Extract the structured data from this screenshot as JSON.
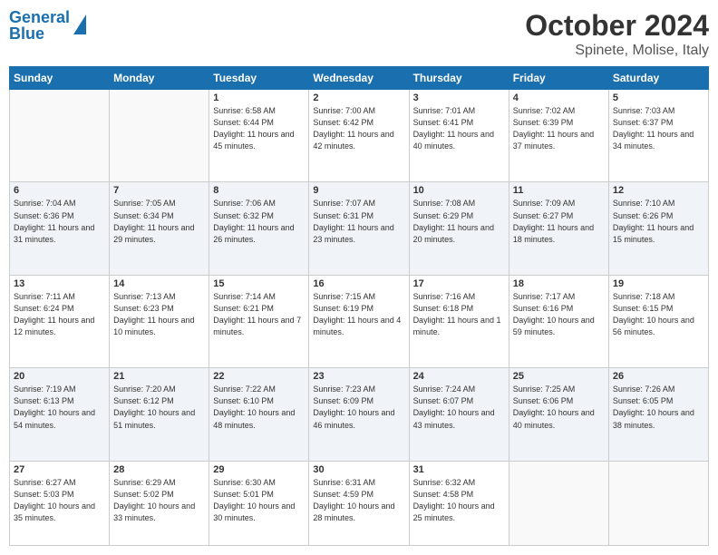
{
  "logo": {
    "line1": "General",
    "line2": "Blue"
  },
  "title": "October 2024",
  "subtitle": "Spinete, Molise, Italy",
  "weekdays": [
    "Sunday",
    "Monday",
    "Tuesday",
    "Wednesday",
    "Thursday",
    "Friday",
    "Saturday"
  ],
  "rows": [
    [
      {
        "day": "",
        "sunrise": "",
        "sunset": "",
        "daylight": ""
      },
      {
        "day": "",
        "sunrise": "",
        "sunset": "",
        "daylight": ""
      },
      {
        "day": "1",
        "sunrise": "Sunrise: 6:58 AM",
        "sunset": "Sunset: 6:44 PM",
        "daylight": "Daylight: 11 hours and 45 minutes."
      },
      {
        "day": "2",
        "sunrise": "Sunrise: 7:00 AM",
        "sunset": "Sunset: 6:42 PM",
        "daylight": "Daylight: 11 hours and 42 minutes."
      },
      {
        "day": "3",
        "sunrise": "Sunrise: 7:01 AM",
        "sunset": "Sunset: 6:41 PM",
        "daylight": "Daylight: 11 hours and 40 minutes."
      },
      {
        "day": "4",
        "sunrise": "Sunrise: 7:02 AM",
        "sunset": "Sunset: 6:39 PM",
        "daylight": "Daylight: 11 hours and 37 minutes."
      },
      {
        "day": "5",
        "sunrise": "Sunrise: 7:03 AM",
        "sunset": "Sunset: 6:37 PM",
        "daylight": "Daylight: 11 hours and 34 minutes."
      }
    ],
    [
      {
        "day": "6",
        "sunrise": "Sunrise: 7:04 AM",
        "sunset": "Sunset: 6:36 PM",
        "daylight": "Daylight: 11 hours and 31 minutes."
      },
      {
        "day": "7",
        "sunrise": "Sunrise: 7:05 AM",
        "sunset": "Sunset: 6:34 PM",
        "daylight": "Daylight: 11 hours and 29 minutes."
      },
      {
        "day": "8",
        "sunrise": "Sunrise: 7:06 AM",
        "sunset": "Sunset: 6:32 PM",
        "daylight": "Daylight: 11 hours and 26 minutes."
      },
      {
        "day": "9",
        "sunrise": "Sunrise: 7:07 AM",
        "sunset": "Sunset: 6:31 PM",
        "daylight": "Daylight: 11 hours and 23 minutes."
      },
      {
        "day": "10",
        "sunrise": "Sunrise: 7:08 AM",
        "sunset": "Sunset: 6:29 PM",
        "daylight": "Daylight: 11 hours and 20 minutes."
      },
      {
        "day": "11",
        "sunrise": "Sunrise: 7:09 AM",
        "sunset": "Sunset: 6:27 PM",
        "daylight": "Daylight: 11 hours and 18 minutes."
      },
      {
        "day": "12",
        "sunrise": "Sunrise: 7:10 AM",
        "sunset": "Sunset: 6:26 PM",
        "daylight": "Daylight: 11 hours and 15 minutes."
      }
    ],
    [
      {
        "day": "13",
        "sunrise": "Sunrise: 7:11 AM",
        "sunset": "Sunset: 6:24 PM",
        "daylight": "Daylight: 11 hours and 12 minutes."
      },
      {
        "day": "14",
        "sunrise": "Sunrise: 7:13 AM",
        "sunset": "Sunset: 6:23 PM",
        "daylight": "Daylight: 11 hours and 10 minutes."
      },
      {
        "day": "15",
        "sunrise": "Sunrise: 7:14 AM",
        "sunset": "Sunset: 6:21 PM",
        "daylight": "Daylight: 11 hours and 7 minutes."
      },
      {
        "day": "16",
        "sunrise": "Sunrise: 7:15 AM",
        "sunset": "Sunset: 6:19 PM",
        "daylight": "Daylight: 11 hours and 4 minutes."
      },
      {
        "day": "17",
        "sunrise": "Sunrise: 7:16 AM",
        "sunset": "Sunset: 6:18 PM",
        "daylight": "Daylight: 11 hours and 1 minute."
      },
      {
        "day": "18",
        "sunrise": "Sunrise: 7:17 AM",
        "sunset": "Sunset: 6:16 PM",
        "daylight": "Daylight: 10 hours and 59 minutes."
      },
      {
        "day": "19",
        "sunrise": "Sunrise: 7:18 AM",
        "sunset": "Sunset: 6:15 PM",
        "daylight": "Daylight: 10 hours and 56 minutes."
      }
    ],
    [
      {
        "day": "20",
        "sunrise": "Sunrise: 7:19 AM",
        "sunset": "Sunset: 6:13 PM",
        "daylight": "Daylight: 10 hours and 54 minutes."
      },
      {
        "day": "21",
        "sunrise": "Sunrise: 7:20 AM",
        "sunset": "Sunset: 6:12 PM",
        "daylight": "Daylight: 10 hours and 51 minutes."
      },
      {
        "day": "22",
        "sunrise": "Sunrise: 7:22 AM",
        "sunset": "Sunset: 6:10 PM",
        "daylight": "Daylight: 10 hours and 48 minutes."
      },
      {
        "day": "23",
        "sunrise": "Sunrise: 7:23 AM",
        "sunset": "Sunset: 6:09 PM",
        "daylight": "Daylight: 10 hours and 46 minutes."
      },
      {
        "day": "24",
        "sunrise": "Sunrise: 7:24 AM",
        "sunset": "Sunset: 6:07 PM",
        "daylight": "Daylight: 10 hours and 43 minutes."
      },
      {
        "day": "25",
        "sunrise": "Sunrise: 7:25 AM",
        "sunset": "Sunset: 6:06 PM",
        "daylight": "Daylight: 10 hours and 40 minutes."
      },
      {
        "day": "26",
        "sunrise": "Sunrise: 7:26 AM",
        "sunset": "Sunset: 6:05 PM",
        "daylight": "Daylight: 10 hours and 38 minutes."
      }
    ],
    [
      {
        "day": "27",
        "sunrise": "Sunrise: 6:27 AM",
        "sunset": "Sunset: 5:03 PM",
        "daylight": "Daylight: 10 hours and 35 minutes."
      },
      {
        "day": "28",
        "sunrise": "Sunrise: 6:29 AM",
        "sunset": "Sunset: 5:02 PM",
        "daylight": "Daylight: 10 hours and 33 minutes."
      },
      {
        "day": "29",
        "sunrise": "Sunrise: 6:30 AM",
        "sunset": "Sunset: 5:01 PM",
        "daylight": "Daylight: 10 hours and 30 minutes."
      },
      {
        "day": "30",
        "sunrise": "Sunrise: 6:31 AM",
        "sunset": "Sunset: 4:59 PM",
        "daylight": "Daylight: 10 hours and 28 minutes."
      },
      {
        "day": "31",
        "sunrise": "Sunrise: 6:32 AM",
        "sunset": "Sunset: 4:58 PM",
        "daylight": "Daylight: 10 hours and 25 minutes."
      },
      {
        "day": "",
        "sunrise": "",
        "sunset": "",
        "daylight": ""
      },
      {
        "day": "",
        "sunrise": "",
        "sunset": "",
        "daylight": ""
      }
    ]
  ]
}
